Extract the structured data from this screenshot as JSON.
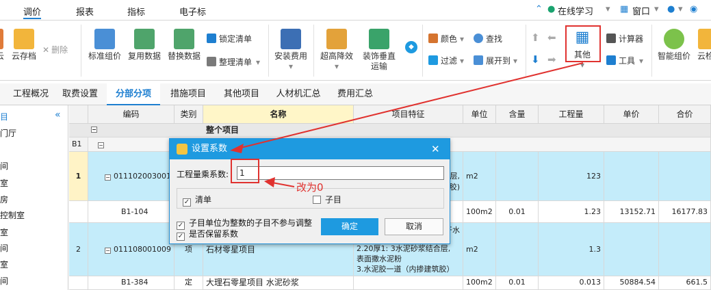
{
  "menubar": {
    "items": [
      "调价",
      "报表",
      "指标",
      "电子标"
    ],
    "online_study": "在线学习",
    "window": "窗口"
  },
  "ribbon": {
    "buttons": {
      "cloud_save": "云存档",
      "delete": "删除",
      "standard_price": "标准组价",
      "reuse_data": "复用数据",
      "replace_data": "替换数据",
      "lock_list": "锁定清单",
      "organize_list": "整理清单",
      "install_fee": "安装费用",
      "super_reduce": "超高降效",
      "decor_transport_l1": "装饰垂直",
      "decor_transport_l2": "运输",
      "color": "颜色",
      "find": "查找",
      "filter": "过滤",
      "expand_to": "展开到",
      "other": "其他",
      "calculator": "计算器",
      "tools": "工具",
      "smart_price": "智能组价",
      "cloud_more": "云检"
    }
  },
  "tabs": [
    "工程概况",
    "取费设置",
    "分部分项",
    "措施项目",
    "其他项目",
    "人材机汇总",
    "费用汇总"
  ],
  "sidebar": {
    "items": [
      "目",
      "门厅",
      "间",
      "室",
      "房",
      "控制室",
      "室",
      "间",
      "室",
      "间"
    ]
  },
  "grid": {
    "headers": [
      "编码",
      "类别",
      "名称",
      "项目特征",
      "单位",
      "含量",
      "工程量",
      "单价",
      "合价"
    ],
    "whole_project": "整个项目",
    "rows": [
      {
        "no": "B1",
        "code": "",
        "type": "",
        "name": "",
        "feature": "",
        "unit": "",
        "content": "",
        "qty": "",
        "price": "",
        "total": ""
      },
      {
        "no": "1",
        "code": "011102003001",
        "type": "",
        "name": "",
        "feature_lines": [
          "层,",
          "胶)"
        ],
        "unit": "m2",
        "content": "",
        "qty": "123",
        "price": "",
        "total": ""
      },
      {
        "no": "",
        "code": "B1-104",
        "type": "",
        "name": "",
        "feature": "",
        "unit": "100m2",
        "content": "0.01",
        "qty": "1.23",
        "price": "13152.71",
        "total": "16177.83"
      },
      {
        "no": "2",
        "code": "011108001009",
        "type": "项",
        "name": "石材零星项目",
        "feature_lines": [
          "干水",
          "2.20厚1: 3水泥砂浆结合层,",
          "表面撒水泥粉",
          "3.水泥胶一道（内掺建筑胶）"
        ],
        "unit": "m2",
        "content": "",
        "qty": "1.3",
        "price": "",
        "total": ""
      },
      {
        "no": "",
        "code": "B1-384",
        "type": "定",
        "name": "大理石零星项目 水泥砂浆",
        "feature": "",
        "unit": "100m2",
        "content": "0.01",
        "qty": "0.013",
        "price": "50884.54",
        "total": "661.5"
      }
    ]
  },
  "dialog": {
    "title": "设置系数",
    "qty_multiplier_label": "工程量乘系数:",
    "qty_multiplier_value": "1",
    "check_list": "清单",
    "check_sub": "子目",
    "opt_integer": "子目单位为整数的子目不参与调整",
    "opt_keep": "是否保留系数",
    "ok": "确定",
    "cancel": "取消"
  },
  "annotation": {
    "text": "改为0",
    "color": "#e0322f"
  },
  "colors": {
    "accent": "#1e9ae0",
    "row_highlight": "#c4ecfa",
    "header_selected": "#fff6c8"
  }
}
